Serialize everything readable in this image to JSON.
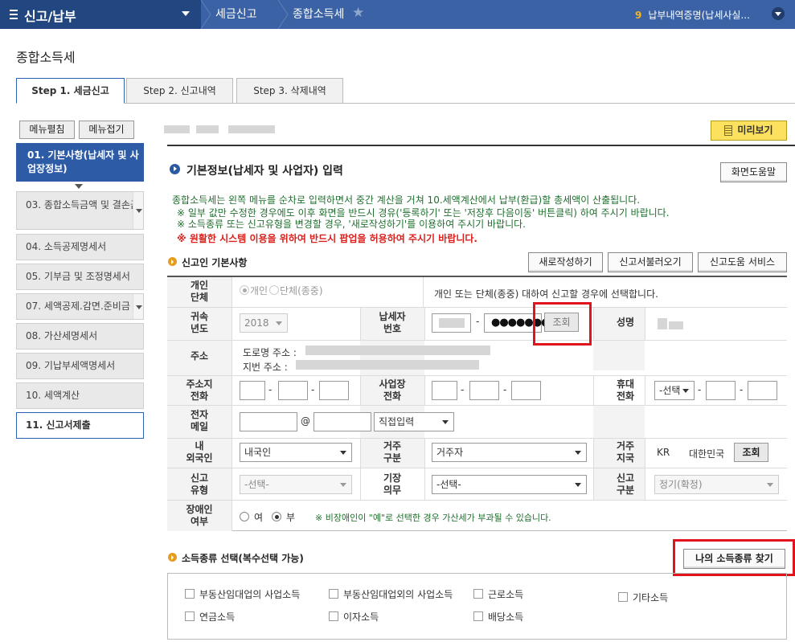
{
  "topbar": {
    "menu_title": "신고/납부",
    "breadcrumb": [
      "세금신고",
      "종합소득세"
    ],
    "notice_count": "9",
    "notice_text": "납부내역증명(납세사실..."
  },
  "page": {
    "title": "종합소득세"
  },
  "tabs": [
    "Step 1. 세금신고",
    "Step 2. 신고내역",
    "Step 3. 삭제내역"
  ],
  "sidebar": {
    "edit_label": "메뉴펼침",
    "collapse_label": "메뉴접기",
    "active_item": "01. 기본사항(납세자 및 사업장정보)",
    "items": [
      "03. 종합소득금액 및 결손금",
      "04. 소득공제명세서",
      "05. 기부금 및 조정명세서",
      "07. 세액공제.감면.준비금",
      "08. 가산세명세서",
      "09. 기납부세액명세서",
      "10. 세액계산",
      "11. 신고서제출"
    ]
  },
  "preview_label": "미리보기",
  "section": {
    "title": "기본정보(납세자 및 사업자) 입력",
    "help_label": "화면도움말",
    "notes": [
      "종합소득세는 왼쪽 메뉴를 순차로 입력하면서 중간 계산을 거쳐 10.세액계산에서 납부(환급)할 총세액이 산출됩니다.",
      "※ 일부 값만 수정한 경우에도 이후 화면을 반드시 경유('등록하기' 또는 '저장후 다음이동' 버튼클릭) 하여 주시기 바랍니다.",
      "※ 소득종류 또는 신고유형을 변경할 경우, '새로작성하기'를 이용하여 주시기 바랍니다."
    ],
    "warning": "※ 원활한 시스템 이용을 위하여 반드시 팝업을 허용하여 주시기 바랍니다."
  },
  "reporter": {
    "title": "신고인 기본사항",
    "buttons": [
      "새로작성하기",
      "신고서불러오기",
      "신고도움 서비스"
    ],
    "labels": {
      "type": "개인\n단체",
      "year": "귀속\n년도",
      "taxpayer_no": "납세자\n번호",
      "name": "성명",
      "address": "주소",
      "addr_phone": "주소지\n전화",
      "biz_phone": "사업장\n전화",
      "mobile": "휴대\n전화",
      "email": "전자\n메일",
      "nationality": "내\n외국인",
      "residence": "거주\n구분",
      "country": "거주\n지국",
      "report_type": "신고\n유형",
      "bookkeeping": "기장\n의무",
      "report_class": "신고\n구분",
      "disabled": "장애인\n여부"
    },
    "type_options": [
      "개인",
      "단체(종중)"
    ],
    "type_hint": "개인 또는 단체(종중) 대하여 신고할 경우에 선택합니다.",
    "year": "2018",
    "taxpayer_masked": "●●●●●●●",
    "lookup_label": "조회",
    "road_addr_label": "도로명 주소 :",
    "lot_addr_label": "지번 주소 :",
    "at_sign": "@",
    "email_domain": "직접입력",
    "mobile_select": "-선택",
    "nationality": "내국인",
    "residence": "거주자",
    "country_code": "KR",
    "country_name": "대한민국",
    "report_type": "-선택-",
    "bookkeeping": "-선택-",
    "report_class": "정기(확정)",
    "disabled_options": [
      "여",
      "부"
    ],
    "disabled_note": "※ 비장애인이 \"예\"로 선택한 경우 가산세가 부과될 수 있습니다."
  },
  "income": {
    "title": "소득종류 선택(복수선택 가능)",
    "find_label": "나의 소득종류 찾기",
    "types": [
      "부동산임대업의 사업소득",
      "부동산임대업외의 사업소득",
      "근로소득",
      "기타소득",
      "연금소득",
      "이자소득",
      "배당소득"
    ]
  }
}
